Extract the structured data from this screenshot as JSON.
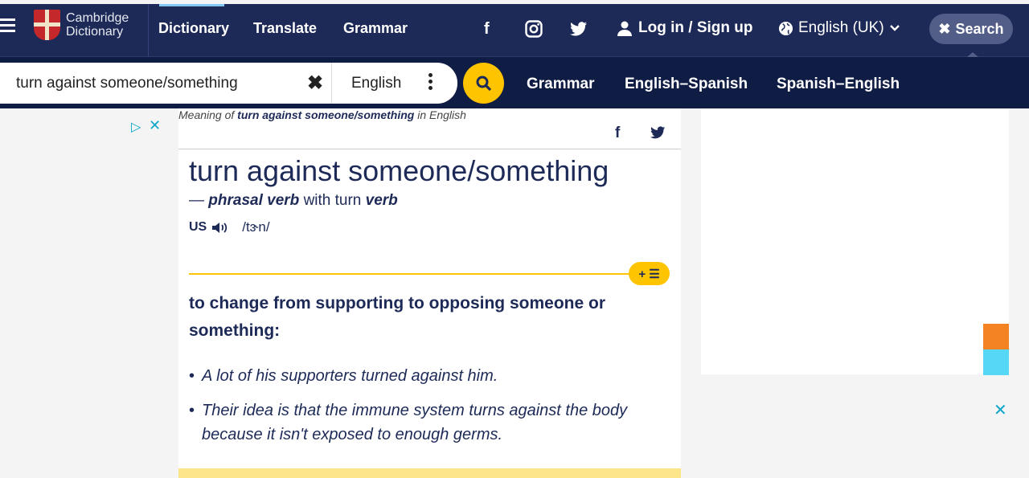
{
  "header": {
    "logo_line1": "Cambridge",
    "logo_line2": "Dictionary",
    "nav": [
      "Dictionary",
      "Translate",
      "Grammar"
    ],
    "login": "Log in / Sign up",
    "language": "English (UK)",
    "search_button": "Search"
  },
  "search": {
    "query": "turn against someone/something",
    "dictionary": "English",
    "links": [
      "Grammar",
      "English–Spanish",
      "Spanish–English"
    ]
  },
  "entry": {
    "meaning_prefix": "Meaning of",
    "meaning_word": "turn against someone/something",
    "meaning_suffix": "in English",
    "headword": "turn against someone/something",
    "pos_dash": "—",
    "pos": "phrasal verb",
    "pos_with": "with turn",
    "pos_verb": "verb",
    "region": "us",
    "ipa": "/tɝn/",
    "list_button": "+ ☰",
    "definition": "to change from supporting to opposing someone or something:",
    "examples": [
      "A lot of his supporters turned against him.",
      "Their idea is that the immune system turns against the body because it isn't exposed to enough germs."
    ]
  },
  "colors": {
    "navy": "#1d2a57",
    "yellow": "#fec400",
    "cyan": "#0aa5c9"
  }
}
